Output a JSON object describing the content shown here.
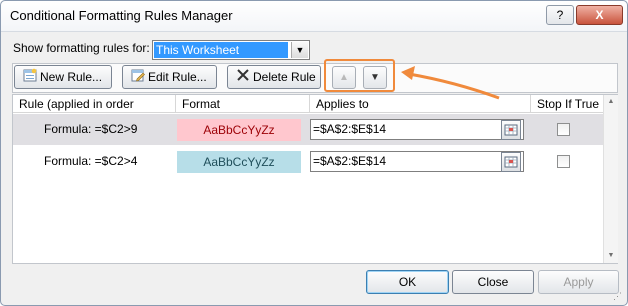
{
  "window": {
    "title": "Conditional Formatting Rules Manager",
    "help_glyph": "?",
    "close_glyph": "X"
  },
  "show_rules": {
    "label": "Show formatting rules for:",
    "selected": "This Worksheet"
  },
  "toolbar": {
    "new_rule": "New Rule...",
    "edit_rule": "Edit Rule...",
    "delete_rule": "Delete Rule"
  },
  "columns": {
    "rule": "Rule (applied in order shown)",
    "format": "Format",
    "applies_to": "Applies to",
    "stop_if_true": "Stop If True"
  },
  "rules": [
    {
      "rule": "Formula: =$C2>9",
      "format_preview": "AaBbCcYyZz",
      "format_color": "#ffc7ce",
      "applies_to": "=$A$2:$E$14",
      "stop_if_true": false,
      "selected": true
    },
    {
      "rule": "Formula: =$C2>4",
      "format_preview": "AaBbCcYyZz",
      "format_color": "#b7dee8",
      "applies_to": "=$A$2:$E$14",
      "stop_if_true": false,
      "selected": false
    }
  ],
  "buttons": {
    "ok": "OK",
    "close": "Close",
    "apply": "Apply"
  },
  "annotation": {
    "color": "#f08a3c"
  }
}
